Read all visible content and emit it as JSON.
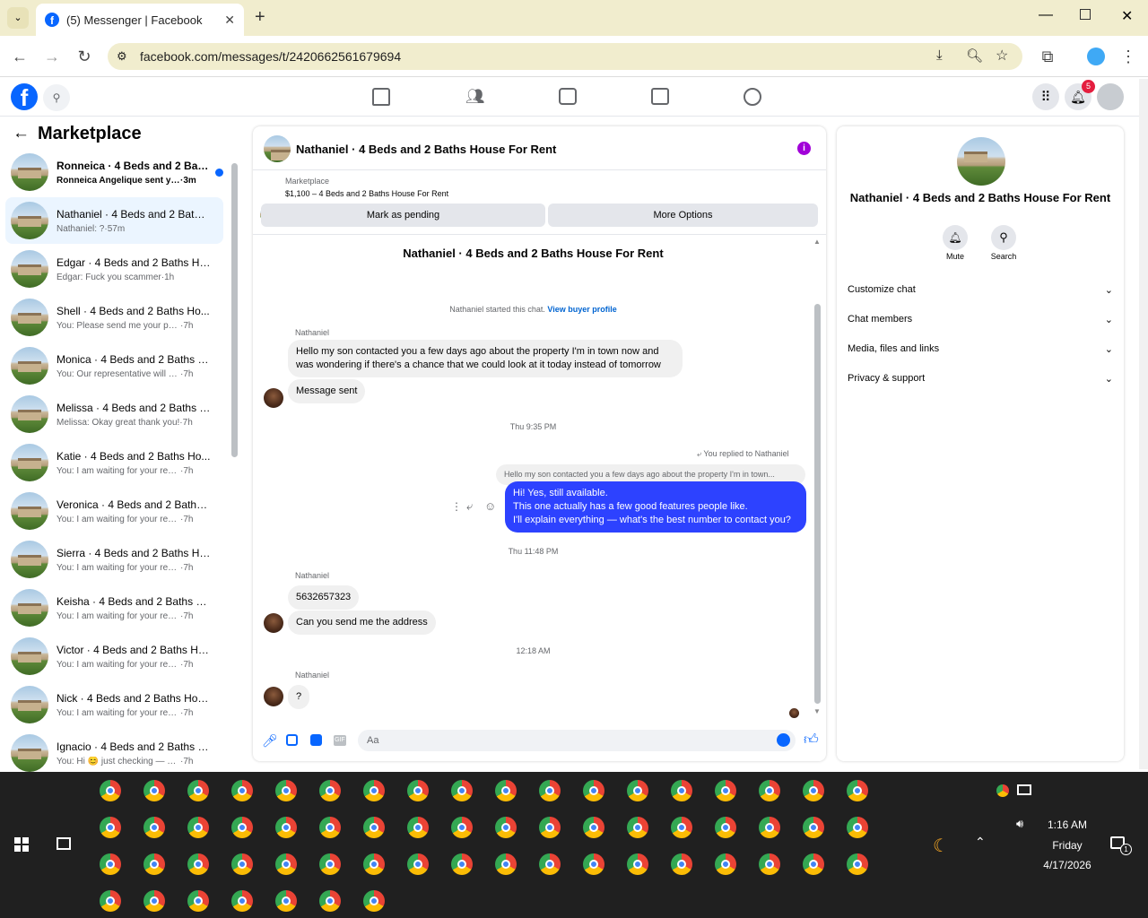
{
  "browser": {
    "tab_title": "(5) Messenger | Facebook",
    "url": "facebook.com/messages/t/2420662561679694"
  },
  "fb": {
    "notifications_count": "5"
  },
  "left": {
    "header": "Marketplace",
    "conversations": [
      {
        "name": "Ronneica · 4 Beds and 2 Baths...",
        "preview": "Ronneica Angelique sent you a...",
        "time": "3m",
        "unread": true
      },
      {
        "name": "Nathaniel · 4 Beds and 2 Baths ...",
        "preview": "Nathaniel: ?",
        "time": "57m",
        "selected": true
      },
      {
        "name": "Edgar · 4 Beds and 2 Baths Hou...",
        "preview": "Edgar: Fuck you scammer",
        "time": "1h"
      },
      {
        "name": "Shell · 4 Beds and 2 Baths Ho...",
        "preview": "You: Please send me your phon...",
        "time": "7h"
      },
      {
        "name": "Monica · 4 Beds and 2 Baths Ho...",
        "preview": "You: Our representative will conta...",
        "time": "7h"
      },
      {
        "name": "Melissa · 4 Beds and 2 Baths Ho...",
        "preview": "Melissa: Okay great thank you!",
        "time": "7h"
      },
      {
        "name": "Katie · 4 Beds and 2 Baths Ho...",
        "preview": "You: I am waiting for your reply,...",
        "time": "7h"
      },
      {
        "name": "Veronica · 4 Beds and 2 Baths H...",
        "preview": "You: I am waiting for your reply, pl...",
        "time": "7h"
      },
      {
        "name": "Sierra · 4 Beds and 2 Baths Hou...",
        "preview": "You: I am waiting for your reply, pl...",
        "time": "7h"
      },
      {
        "name": "Keisha · 4 Beds and 2 Baths Ho...",
        "preview": "You: I am waiting for your reply, pl...",
        "time": "7h"
      },
      {
        "name": "Victor · 4 Beds and 2 Baths Hou...",
        "preview": "You: I am waiting for your reply, pl...",
        "time": "7h"
      },
      {
        "name": "Nick · 4 Beds and 2 Baths Hous...",
        "preview": "You: I am waiting for your reply, pl...",
        "time": "7h"
      },
      {
        "name": "Ignacio · 4 Beds and 2 Baths Ho...",
        "preview": "You: Hi 😊 just checking — are yo...",
        "time": "7h"
      }
    ]
  },
  "chat": {
    "title": "Nathaniel · 4 Beds and 2 Baths House For Rent",
    "listing_category": "Marketplace",
    "listing_price": "$1,100 – 4 Beds and 2 Baths House For Rent",
    "pending_button": "Mark as pending",
    "more_button": "More Options",
    "thread_title": "Nathaniel · 4 Beds and 2 Baths House For Rent",
    "started_text": "Nathaniel started this chat.",
    "view_profile": "View buyer profile",
    "sender_name": "Nathaniel",
    "msg1": "Hello my son contacted you a few days ago about the property I'm in town now and was wondering if there's a chance that we could look at it today instead of tomorrow",
    "msg2": "Message sent",
    "time1": "Thu 9:35 PM",
    "replied_label": "You replied to Nathaniel",
    "quoted": "Hello my son contacted you a few days ago about the property I'm in town...",
    "reply_line1": "Hi! Yes, still available.",
    "reply_line2": "This one actually has a few good features people like.",
    "reply_line3": "I'll explain everything — what's the best number to contact you?",
    "time2": "Thu 11:48 PM",
    "msg3": "5632657323",
    "msg4": "Can you send me the address",
    "time3": "12:18 AM",
    "msg5": "?",
    "input_placeholder": "Aa"
  },
  "right": {
    "title": "Nathaniel · 4 Beds and 2 Baths House For Rent",
    "mute": "Mute",
    "search": "Search",
    "sections": [
      "Customize chat",
      "Chat members",
      "Media, files and links",
      "Privacy & support"
    ]
  },
  "taskbar": {
    "time": "1:16 AM",
    "day": "Friday",
    "date": "4/17/2026",
    "notif_count": "1"
  }
}
